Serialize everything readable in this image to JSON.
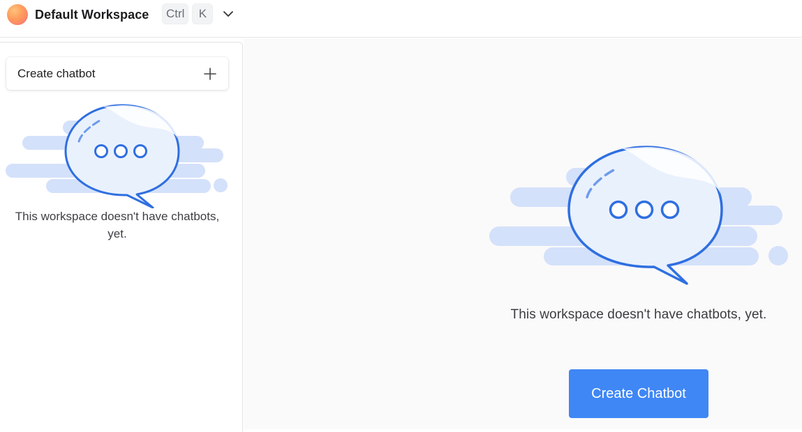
{
  "header": {
    "workspace_name": "Default Workspace",
    "shortcut_keys": [
      "Ctrl",
      "K"
    ],
    "avatar_colors": [
      "#ffc27a",
      "#f56f79"
    ]
  },
  "sidebar": {
    "create_label": "Create chatbot",
    "empty_text": "This workspace doesn't have chatbots, yet."
  },
  "main": {
    "empty_text": "This workspace doesn't have chatbots, yet.",
    "create_button_label": "Create Chatbot"
  },
  "colors": {
    "accent": "#3f87f5",
    "bubble_stroke": "#2f6fe0",
    "cloud": "#d4e1fa",
    "bubble_fill": "#e9f1fd"
  }
}
